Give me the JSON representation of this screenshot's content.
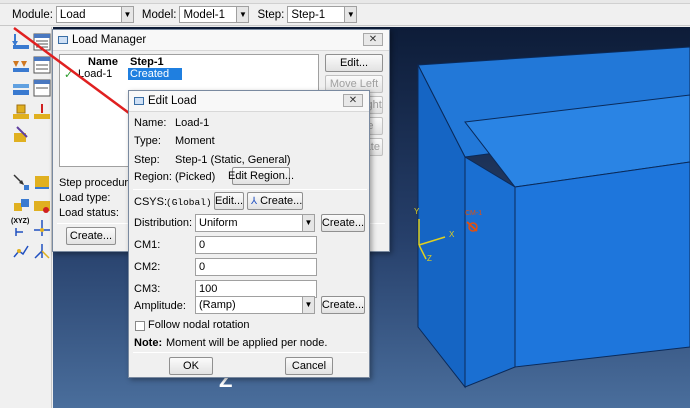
{
  "context_bar": {
    "module_label": "Module:",
    "module_value": "Load",
    "model_label": "Model:",
    "model_value": "Model-1",
    "step_label": "Step:",
    "step_value": "Step-1"
  },
  "toolbox": {
    "icons": [
      "load-create-icon",
      "load-manager-icon",
      "bc-create-icon",
      "bc-manager-icon",
      "predefined-field-icon",
      "predefined-field-manager-icon",
      "load-case-icon",
      "load-case-manager-icon",
      "special-icon",
      "create-amplitude-icon",
      "connector-load-icon",
      "manager-icon",
      "datum-csys-icon",
      "datum-tools-icon",
      "coordinate-system-icon",
      "query-icon"
    ],
    "xyz_label": "(XYZ)"
  },
  "viewport": {
    "triad": {
      "x": "X",
      "y": "Y",
      "z": "Z"
    },
    "moment_label": "CM-1",
    "axis_label_z": "Z"
  },
  "load_manager": {
    "title": "Load Manager",
    "col_name": "Name",
    "col_step": "Step-1",
    "rows": [
      {
        "name": "Load-1",
        "status": "Created"
      }
    ],
    "buttons": {
      "edit": "Edit...",
      "move_left": "Move Left",
      "move_right": "Move Right",
      "activate": "Activate",
      "deactivate": "Deactivate",
      "create": "Create..."
    },
    "step_procedure_label": "Step procedure:",
    "load_type_label": "Load type:",
    "load_status_label": "Load status:"
  },
  "edit_load": {
    "title": "Edit Load",
    "name_label": "Name:",
    "name_value": "Load-1",
    "type_label": "Type:",
    "type_value": "Moment",
    "step_label": "Step:",
    "step_value": "Step-1 (Static, General)",
    "region_label": "Region:",
    "region_value": "(Picked)",
    "edit_region_button": "Edit Region...",
    "csys_label": "CSYS:",
    "csys_value": "(Global)",
    "csys_edit_button": "Edit...",
    "csys_create_button": "Create...",
    "distribution_label": "Distribution:",
    "distribution_value": "Uniform",
    "distribution_create_button": "Create...",
    "cm1_label": "CM1:",
    "cm1_value": "0",
    "cm2_label": "CM2:",
    "cm2_value": "0",
    "cm3_label": "CM3:",
    "cm3_value": "100",
    "amplitude_label": "Amplitude:",
    "amplitude_value": "(Ramp)",
    "amplitude_create_button": "Create...",
    "follow_rotation_label": "Follow nodal rotation",
    "note_bold": "Note:",
    "note_text": "Moment will be applied per node.",
    "ok_button": "OK",
    "cancel_button": "Cancel"
  },
  "colors": {
    "solid": "#1f7fe0",
    "arrow": "#e03030",
    "selection": "#1f7fe0"
  }
}
